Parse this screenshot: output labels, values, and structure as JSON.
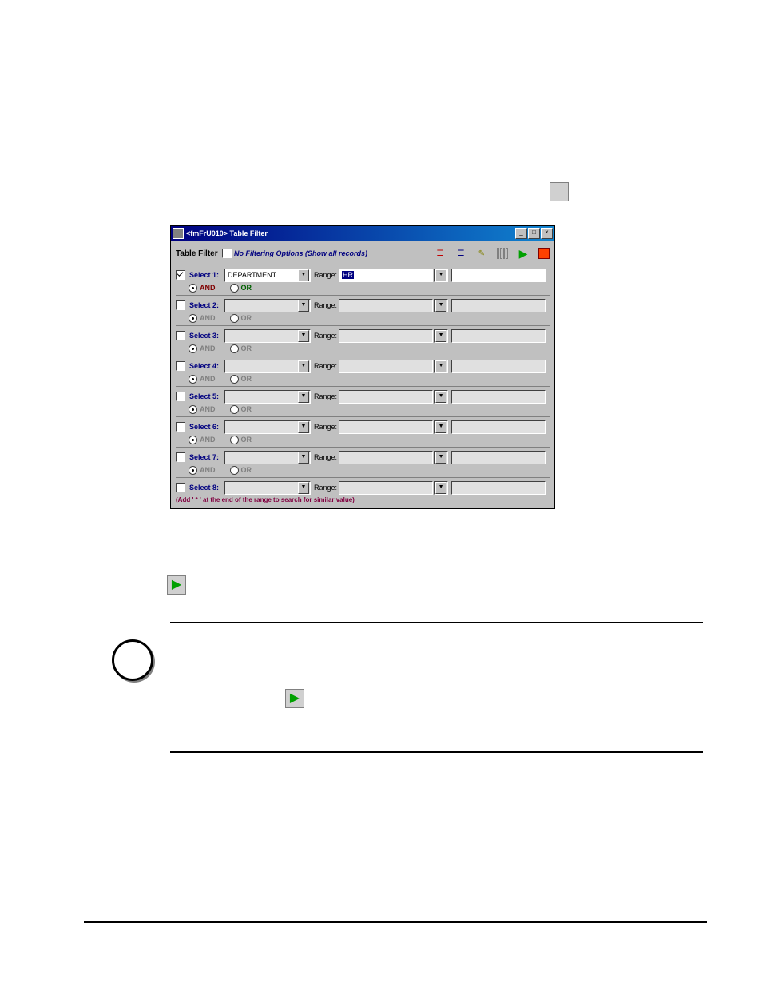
{
  "window": {
    "title": "<fmFrU010> Table Filter",
    "header_label": "Table Filter",
    "no_filter_label": "No Filtering Options (Show all records)",
    "range_label": "Range:",
    "and_label": "AND",
    "or_label": "OR",
    "hint": "(Add ' * ' at the end of the range to search for similar value)"
  },
  "rows": [
    {
      "label": "Select 1:",
      "checked": true,
      "field": "DEPARTMENT",
      "v1": "HR",
      "v2": "",
      "and": true,
      "enabled": true
    },
    {
      "label": "Select 2:",
      "checked": false,
      "field": "",
      "v1": "",
      "v2": "",
      "and": true,
      "enabled": false
    },
    {
      "label": "Select 3:",
      "checked": false,
      "field": "",
      "v1": "",
      "v2": "",
      "and": true,
      "enabled": false
    },
    {
      "label": "Select 4:",
      "checked": false,
      "field": "",
      "v1": "",
      "v2": "",
      "and": true,
      "enabled": false
    },
    {
      "label": "Select 5:",
      "checked": false,
      "field": "",
      "v1": "",
      "v2": "",
      "and": true,
      "enabled": false
    },
    {
      "label": "Select 6:",
      "checked": false,
      "field": "",
      "v1": "",
      "v2": "",
      "and": true,
      "enabled": false
    },
    {
      "label": "Select 7:",
      "checked": false,
      "field": "",
      "v1": "",
      "v2": "",
      "and": true,
      "enabled": false
    },
    {
      "label": "Select 8:",
      "checked": false,
      "field": "",
      "v1": "",
      "v2": "",
      "and": true,
      "enabled": false
    }
  ]
}
